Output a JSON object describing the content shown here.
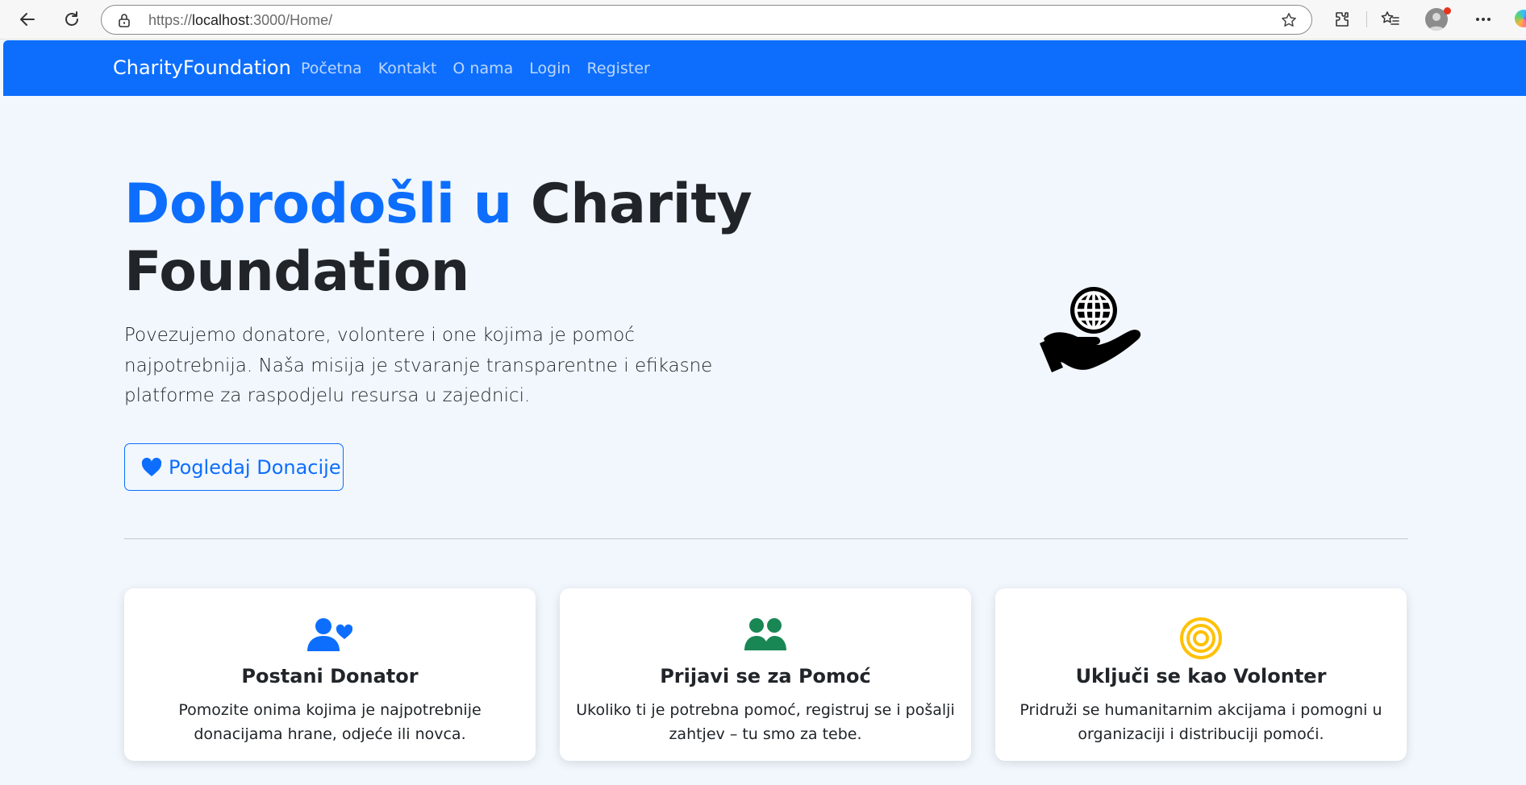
{
  "browser": {
    "url_prefix": "https://",
    "url_host": "localhost",
    "url_rest": ":3000/Home/"
  },
  "navbar": {
    "brand": "CharityFoundation",
    "links": [
      "Početna",
      "Kontakt",
      "O nama",
      "Login",
      "Register"
    ]
  },
  "hero": {
    "title_accent": "Dobrodošli u",
    "title_rest": " Charity Foundation",
    "lead": "Povezujemo donatore, volontere i one kojima je pomoć najpotrebnija. Naša misija je stvaranje transparentne i efikasne platforme za raspodjelu resursa u zajednici.",
    "button_label": "Pogledaj Donacije",
    "button_icon": "heart-icon",
    "illustration_icon": "globe-in-hand-icon"
  },
  "cards": [
    {
      "icon": "person-heart-icon",
      "icon_color": "#0d6efd",
      "title": "Postani Donator",
      "text": "Pomozite onima kojima je najpotrebnije donacijama hrane, odjeće ili novca."
    },
    {
      "icon": "people-icon",
      "icon_color": "#198754",
      "title": "Prijavi se za Pomoć",
      "text": "Ukoliko ti je potrebna pomoć, registruj se i pošalji zahtjev – tu smo za tebe."
    },
    {
      "icon": "target-icon",
      "icon_color": "#ffc107",
      "title": "Uključi se kao Volonter",
      "text": "Pridruži se humanitarnim akcijama i pomogni u organizaciji i distribuciji pomoći."
    }
  ],
  "colors": {
    "primary": "#0d6efd",
    "background": "#f1f7fd",
    "success": "#198754",
    "warning": "#ffc107"
  }
}
